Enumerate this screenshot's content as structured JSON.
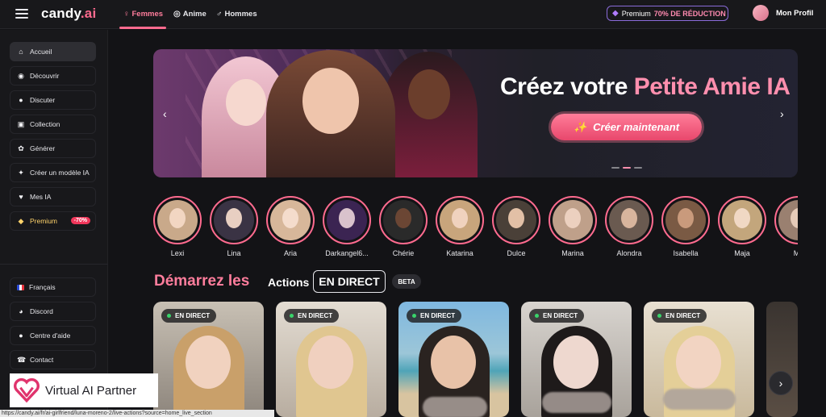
{
  "brand": {
    "logo": "candy",
    "logo_tld": ".ai"
  },
  "nav": {
    "tabs": [
      {
        "label": "Femmes",
        "icon": "♀"
      },
      {
        "label": "Anime",
        "icon": "◎"
      },
      {
        "label": "Hommes",
        "icon": "♂"
      }
    ]
  },
  "premium_promo": {
    "prefix": "Premium",
    "discount": "70% DE RÉDUCTION"
  },
  "profile": {
    "label": "Mon Profil"
  },
  "sidebar": {
    "items": [
      {
        "label": "Accueil",
        "icon": "home-icon"
      },
      {
        "label": "Découvrir",
        "icon": "compass-icon"
      },
      {
        "label": "Discuter",
        "icon": "chat-icon"
      },
      {
        "label": "Collection",
        "icon": "collection-icon"
      },
      {
        "label": "Générer",
        "icon": "generate-icon"
      },
      {
        "label": "Créer un modèle IA",
        "icon": "wand-icon"
      },
      {
        "label": "Mes IA",
        "icon": "my-ai-icon"
      },
      {
        "label": "Premium",
        "icon": "diamond-icon",
        "badge": "-70%"
      }
    ],
    "footer_items": [
      {
        "label": "Français",
        "icon": "flag-fr-icon"
      },
      {
        "label": "Discord",
        "icon": "discord-icon"
      },
      {
        "label": "Centre d'aide",
        "icon": "help-icon"
      },
      {
        "label": "Contact",
        "icon": "contact-icon"
      }
    ]
  },
  "hero": {
    "title_white": "Créez votre ",
    "title_pink": "Petite Amie IA",
    "cta": "Créer maintenant"
  },
  "stories": [
    {
      "name": "Lexi"
    },
    {
      "name": "Lina"
    },
    {
      "name": "Aria"
    },
    {
      "name": "Darkangel6..."
    },
    {
      "name": "Chérie"
    },
    {
      "name": "Katarina"
    },
    {
      "name": "Dulce"
    },
    {
      "name": "Marina"
    },
    {
      "name": "Alondra"
    },
    {
      "name": "Isabella"
    },
    {
      "name": "Maja"
    },
    {
      "name": "Mo"
    }
  ],
  "live_section": {
    "title": "Démarrez les",
    "word": "Actions",
    "boxed": "EN DIRECT",
    "beta": "BETA",
    "live_chip": "EN DIRECT"
  },
  "watermark": {
    "text": "Virtual AI Partner"
  },
  "status_url": "https://candy.ai/fr/ai-girlfriend/luna-moreno-2/live-actions?source=home_live_section",
  "colors": {
    "accent": "#ff6b8f",
    "background": "#131316",
    "sidebar": "#18181b",
    "premium_gold": "#ffd36b"
  }
}
